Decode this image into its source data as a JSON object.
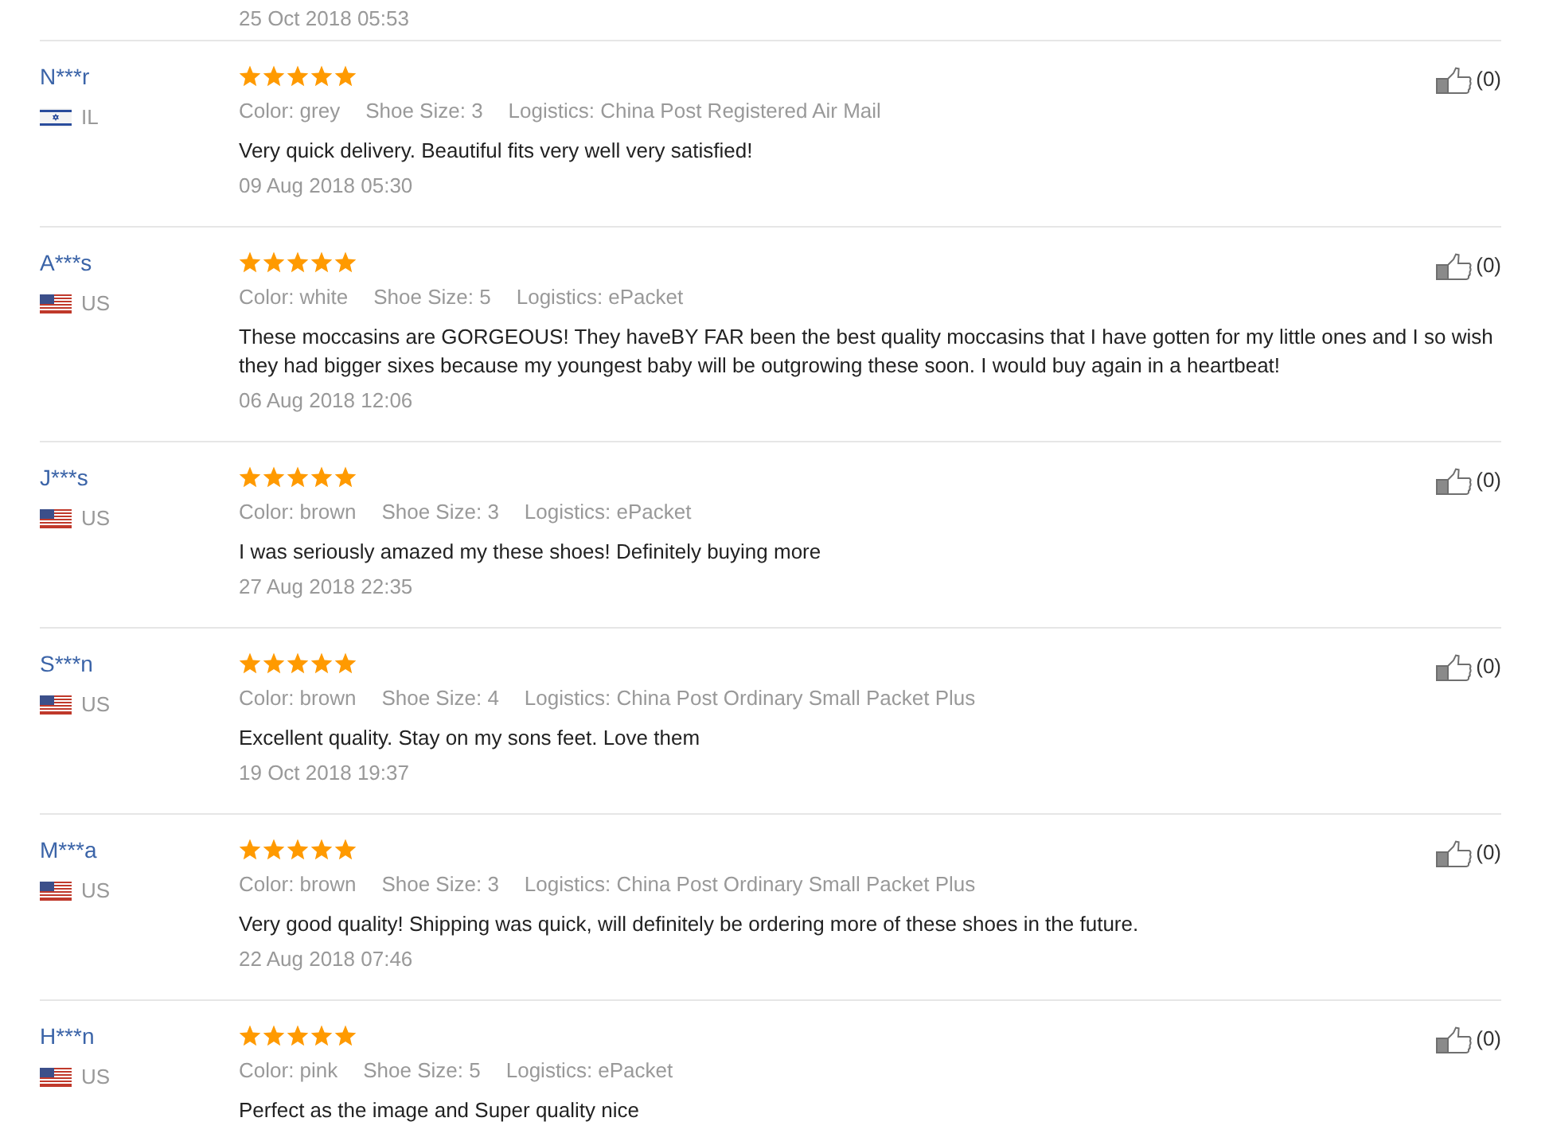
{
  "previous_date": "25 Oct 2018 05:53",
  "reviews": [
    {
      "name": "N***r",
      "flag": {
        "kind": "il"
      },
      "country": "IL",
      "stars": 5,
      "likes": "(0)",
      "attributes": [
        "Color: grey",
        "Shoe Size: 3",
        "Logistics: China Post Registered Air Mail"
      ],
      "text": "Very quick delivery. Beautiful fits very well very satisfied!",
      "date": "09 Aug 2018 05:30"
    },
    {
      "name": "A***s",
      "flag": {
        "kind": "us"
      },
      "country": "US",
      "stars": 5,
      "likes": "(0)",
      "attributes": [
        "Color: white",
        "Shoe Size: 5",
        "Logistics: ePacket"
      ],
      "text": "These moccasins are GORGEOUS! They haveBY FAR been the best quality moccasins that I have gotten for my little ones and I so wish they had bigger sixes because my youngest baby will be outgrowing these soon. I would buy again in a heartbeat!",
      "date": "06 Aug 2018 12:06"
    },
    {
      "name": "J***s",
      "flag": {
        "kind": "us"
      },
      "country": "US",
      "stars": 5,
      "likes": "(0)",
      "attributes": [
        "Color: brown",
        "Shoe Size: 3",
        "Logistics: ePacket"
      ],
      "text": "I was seriously amazed my these shoes! Definitely buying more",
      "date": "27 Aug 2018 22:35"
    },
    {
      "name": "S***n",
      "flag": {
        "kind": "us"
      },
      "country": "US",
      "stars": 5,
      "likes": "(0)",
      "attributes": [
        "Color: brown",
        "Shoe Size: 4",
        "Logistics: China Post Ordinary Small Packet Plus"
      ],
      "text": "Excellent quality. Stay on my sons feet. Love them",
      "date": "19 Oct 2018 19:37"
    },
    {
      "name": "M***a",
      "flag": {
        "kind": "us"
      },
      "country": "US",
      "stars": 5,
      "likes": "(0)",
      "attributes": [
        "Color: brown",
        "Shoe Size: 3",
        "Logistics: China Post Ordinary Small Packet Plus"
      ],
      "text": "Very good quality! Shipping was quick, will definitely be ordering more of these shoes in the future.",
      "date": "22 Aug 2018 07:46"
    },
    {
      "name": "H***n",
      "flag": {
        "kind": "us"
      },
      "country": "US",
      "stars": 5,
      "likes": "(0)",
      "attributes": [
        "Color: pink",
        "Shoe Size: 5",
        "Logistics: ePacket"
      ],
      "text": "Perfect as the image and Super quality nice"
    }
  ]
}
